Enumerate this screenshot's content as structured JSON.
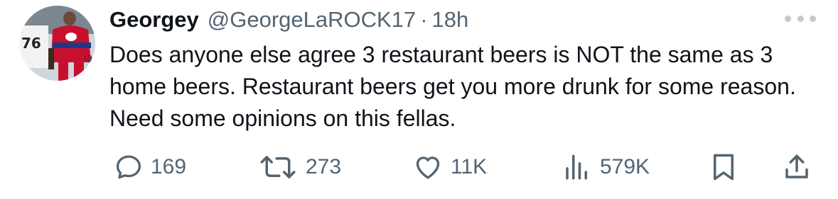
{
  "tweet": {
    "display_name": "Georgey",
    "handle": "@GeorgeLaROCK17",
    "separator": "·",
    "time": "18h",
    "text": "Does anyone else agree 3 restaurant beers is NOT the same as 3 home beers. Restaurant beers get you more drunk for some reason. Need some opinions on this fellas."
  },
  "avatar": {
    "jersey_number": "76"
  },
  "actions": {
    "replies": "169",
    "reposts": "273",
    "likes": "11K",
    "views": "579K"
  },
  "icons": {
    "reply": "speech-bubble-icon",
    "repost": "repost-arrows-icon",
    "like": "heart-icon",
    "views": "bar-chart-icon",
    "bookmark": "bookmark-icon",
    "share": "share-upload-icon",
    "more": "more-dots-icon"
  },
  "colors": {
    "text_primary": "#0f1419",
    "text_secondary": "#536471",
    "more_dots": "#c4c9ce"
  }
}
